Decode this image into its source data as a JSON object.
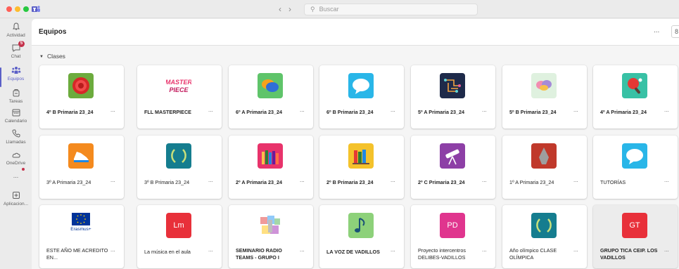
{
  "search": {
    "placeholder": "Buscar"
  },
  "rail": [
    {
      "label": "Actividad"
    },
    {
      "label": "Chat",
      "badge": "5"
    },
    {
      "label": "Equipos"
    },
    {
      "label": "Tareas"
    },
    {
      "label": "Calendario"
    },
    {
      "label": "Llamadas"
    },
    {
      "label": "OneDrive"
    },
    {
      "label": "..."
    },
    {
      "label": "Aplicacion..."
    }
  ],
  "header": {
    "title": "Equipos",
    "more": "...",
    "btn": "8"
  },
  "section": {
    "label": "Clases"
  },
  "teams": [
    {
      "name": "4º B Primaria 23_24",
      "bold": true,
      "color": "#6cab3d",
      "icon": "target-icon"
    },
    {
      "name": "FLL MASTERPIECE",
      "bold": true,
      "color": "#ffffff",
      "icon": "masterpiece-logo"
    },
    {
      "name": "6º A Primaria 23_24",
      "bold": true,
      "color": "#5fc46a",
      "icon": "chat-bubbles-icon"
    },
    {
      "name": "6º B Primaria 23_24",
      "bold": true,
      "color": "#29b6e8",
      "icon": "speech-bubble-icon"
    },
    {
      "name": "5º A Primaria 23_24",
      "bold": true,
      "color": "#1e2a4a",
      "icon": "circuit-icon"
    },
    {
      "name": "5º B Primaria 23_24",
      "bold": true,
      "color": "#dff1df",
      "icon": "brain-icon"
    },
    {
      "name": "4º A Primaria 23_24",
      "bold": true,
      "color": "#38c1a5",
      "icon": "ping-pong-icon"
    },
    {
      "name": "3º A Primaria 23_24",
      "bold": false,
      "color": "#f48a1e",
      "icon": "sneaker-icon"
    },
    {
      "name": "3º B Primaria 23_24",
      "bold": false,
      "color": "#157d8f",
      "icon": "laurel-icon"
    },
    {
      "name": "2º A Primaria 23_24",
      "bold": true,
      "color": "#e8336b",
      "icon": "pencils-icon"
    },
    {
      "name": "2º B Primaria 23_24",
      "bold": true,
      "color": "#f4c22b",
      "icon": "books-icon"
    },
    {
      "name": "2º C Primaria 23_24",
      "bold": true,
      "color": "#8d3fa6",
      "icon": "telescope-icon"
    },
    {
      "name": "1º A Primaria 23_24",
      "bold": false,
      "color": "#c0392b",
      "icon": "arrowhead-icon"
    },
    {
      "name": "TUTORÍAS",
      "bold": false,
      "color": "#29b6e8",
      "icon": "speech-bubble-icon"
    },
    {
      "name": "ESTE AÑO ME ACREDITO EN...",
      "bold": false,
      "color": "#ffffff",
      "icon": "erasmus-logo",
      "logo_text": "Erasmus+"
    },
    {
      "name": "La música en el aula",
      "bold": false,
      "color": "#e8303a",
      "icon": "initials",
      "initials": "Lm"
    },
    {
      "name": "SEMINARIO RADIO TEAMS - GRUPO I",
      "bold": true,
      "color": "#ffffff",
      "icon": "collage-icon"
    },
    {
      "name": "LA VOZ DE VADILLOS",
      "bold": true,
      "color": "#8dd17a",
      "icon": "music-note-icon"
    },
    {
      "name": "Proyecto intercentros DELIBES-VADILLOS",
      "bold": false,
      "color": "#e0358e",
      "icon": "initials",
      "initials": "PD"
    },
    {
      "name": "Año olímpico CLASE OLÍMPICA",
      "bold": false,
      "color": "#157d8f",
      "icon": "laurel-icon"
    },
    {
      "name": "GRUPO TICA CEIP. LOS VADILLOS",
      "bold": true,
      "color": "#e8303a",
      "icon": "initials",
      "initials": "GT"
    }
  ],
  "card_more": "..."
}
